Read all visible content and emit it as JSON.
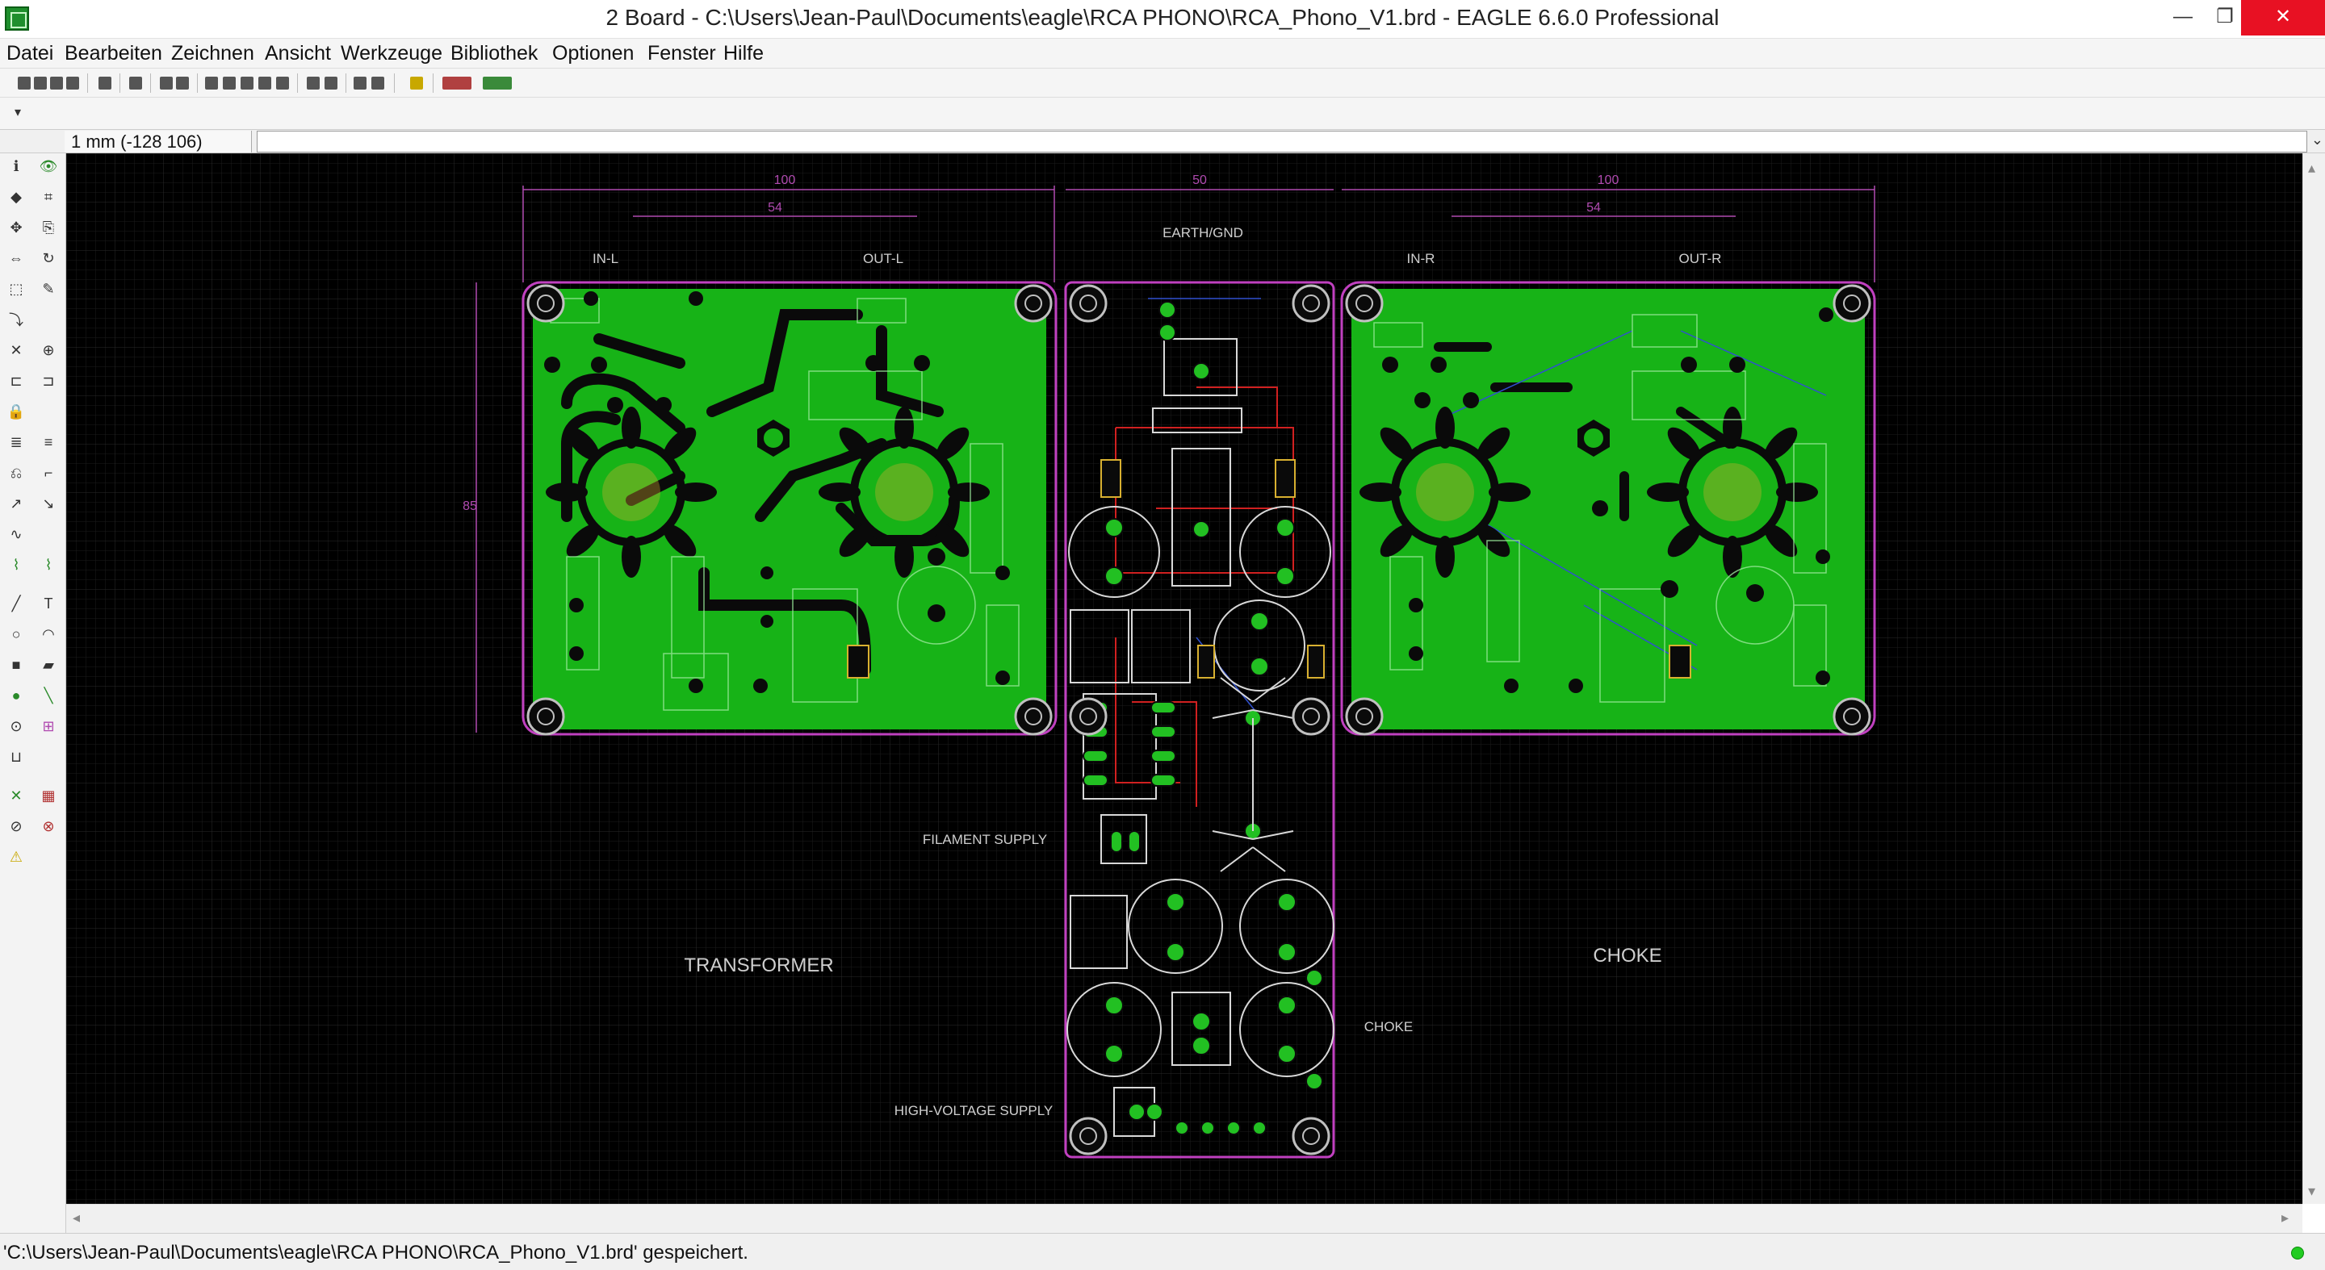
{
  "window": {
    "title": "2 Board - C:\\Users\\Jean-Paul\\Documents\\eagle\\RCA PHONO\\RCA_Phono_V1.brd - EAGLE 6.6.0 Professional",
    "min_glyph": "—",
    "max_glyph": "❐",
    "close_glyph": "✕"
  },
  "menu": [
    "Datei",
    "Bearbeiten",
    "Zeichnen",
    "Ansicht",
    "Werkzeuge",
    "Bibliothek",
    "Optionen",
    "Fenster",
    "Hilfe"
  ],
  "command_row": {
    "coordinate": "1 mm (-128 106)",
    "command_value": "",
    "dropdown_glyph": "⌄"
  },
  "board": {
    "labels": {
      "transformer": "TRANSFORMER",
      "choke": "CHOKE",
      "earth_gnd": "EARTH/GND",
      "filament_supply": "FILAMENT SUPPLY",
      "choke_small": "CHOKE",
      "high_voltage_supply": "HIGH-VOLTAGE SUPPLY",
      "in_l": "IN-L",
      "out_l": "OUT-L",
      "in_r": "IN-R",
      "out_r": "OUT-R"
    },
    "dimensions": {
      "left_width": "100",
      "left_inner": "54",
      "center_width": "50",
      "right_width": "100",
      "right_inner": "54",
      "left_height": "85"
    },
    "colors": {
      "copper_pour": "#17b317",
      "copper_dark": "#0d7a0d",
      "outline": "#c040c0",
      "pad": "#22c022",
      "trace_red": "#d02020",
      "trace_blue": "#3050d0",
      "silkscreen": "#d8d8d8",
      "grid": "#2a2a2a"
    }
  },
  "status": {
    "message": "'C:\\Users\\Jean-Paul\\Documents\\eagle\\RCA PHONO\\RCA_Phono_V1.brd' gespeichert."
  }
}
